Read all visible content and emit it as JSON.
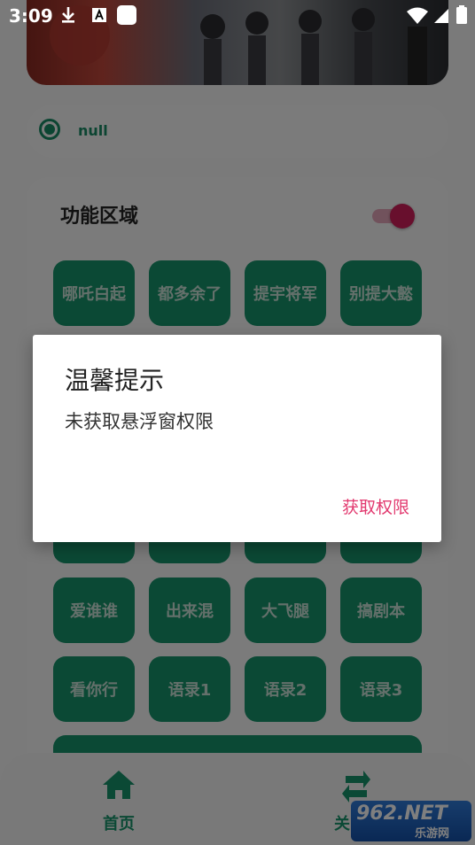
{
  "status_bar": {
    "time": "3:09",
    "icons": [
      "download-icon",
      "a11y-icon",
      "app-icon",
      "wifi-icon",
      "signal-icon",
      "battery-icon"
    ]
  },
  "banner": {
    "image": "banner-image"
  },
  "null_card": {
    "label": "null"
  },
  "function_area": {
    "title": "功能区域",
    "toggle_on": true,
    "buttons": [
      "哪吒白起",
      "都多余了",
      "提宇将军",
      "别提大懿",
      "",
      "",
      "",
      "",
      "",
      "",
      "",
      "",
      "爱谁谁",
      "出来混",
      "大飞腿",
      "搞剧本",
      "看你行",
      "语录1",
      "语录2",
      "语录3"
    ]
  },
  "bottom_nav": {
    "items": [
      {
        "label": "首页",
        "icon": "home-icon"
      },
      {
        "label": "关",
        "icon": "switch-icon"
      }
    ]
  },
  "watermark": {
    "big": "962.NET",
    "small": "乐游网"
  },
  "dialog": {
    "title": "温馨提示",
    "message": "未获取悬浮窗权限",
    "button": "获取权限"
  },
  "colors": {
    "green": "#17936a",
    "pink": "#e2396f",
    "toggle": "#d11e5b"
  }
}
